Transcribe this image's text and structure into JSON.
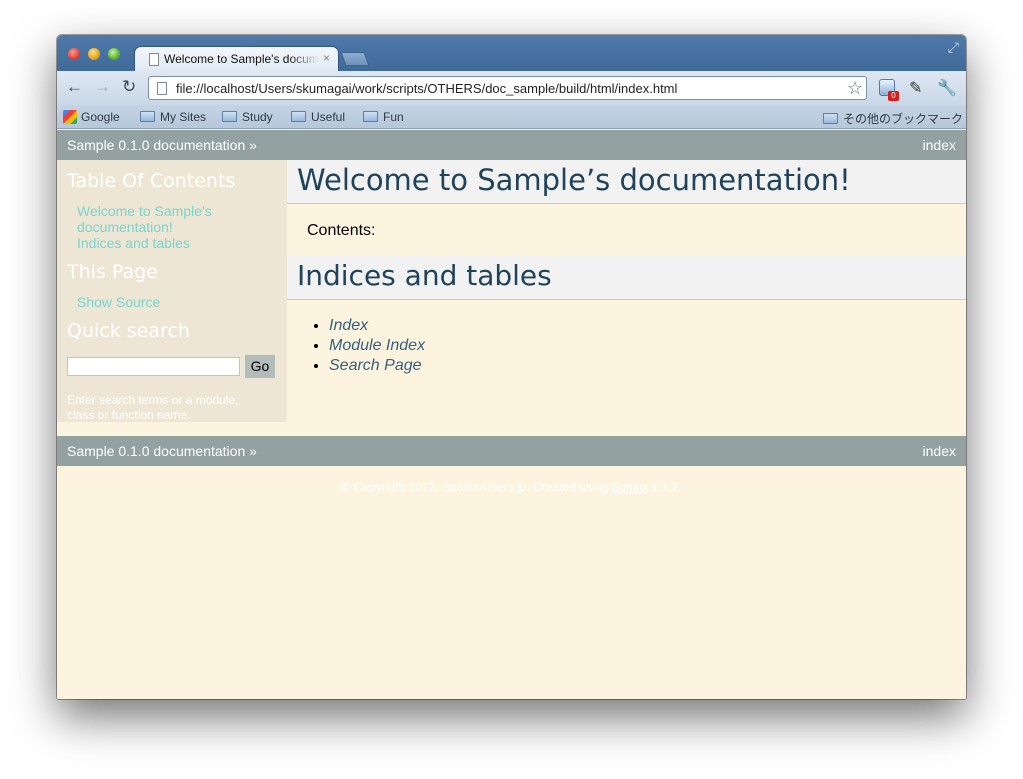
{
  "browser": {
    "tab_title": "Welcome to Sample's documentation!",
    "tab_close": "×",
    "url": "file://localhost/Users/skumagai/work/scripts/OTHERS/doc_sample/build/html/index.html",
    "extension_badge": "0",
    "bookmarks": [
      "Google",
      "My Sites",
      "Study",
      "Useful",
      "Fun"
    ],
    "other_bookmarks": "その他のブックマーク"
  },
  "page": {
    "relbar_home": "Sample 0.1.0 documentation »",
    "relbar_index": "index",
    "sidebar": {
      "toc_heading": "Table Of Contents",
      "toc_items": [
        "Welcome to Sample's documentation!",
        "Indices and tables"
      ],
      "this_page_heading": "This Page",
      "show_source": "Show Source",
      "quick_search_heading": "Quick search",
      "go_button": "Go",
      "search_hint": "Enter search terms or a module, class or function name."
    },
    "main": {
      "title": "Welcome to Sample’s documentation!",
      "contents_label": "Contents:",
      "indices_heading": "Indices and tables",
      "links": [
        "Index",
        "Module Index",
        "Search Page"
      ]
    },
    "footer": {
      "copyright": "© Copyright 2012, Sphinx-Users.jp. Created using ",
      "sphinx": "Sphinx",
      "version": " 1.1.2."
    }
  },
  "colors": {
    "relbar": "#93a1a1",
    "sidebar": "#eee6d5",
    "body": "#fdf4e0",
    "heading_text": "#20435c",
    "sidebar_link": "#77d4cf"
  }
}
